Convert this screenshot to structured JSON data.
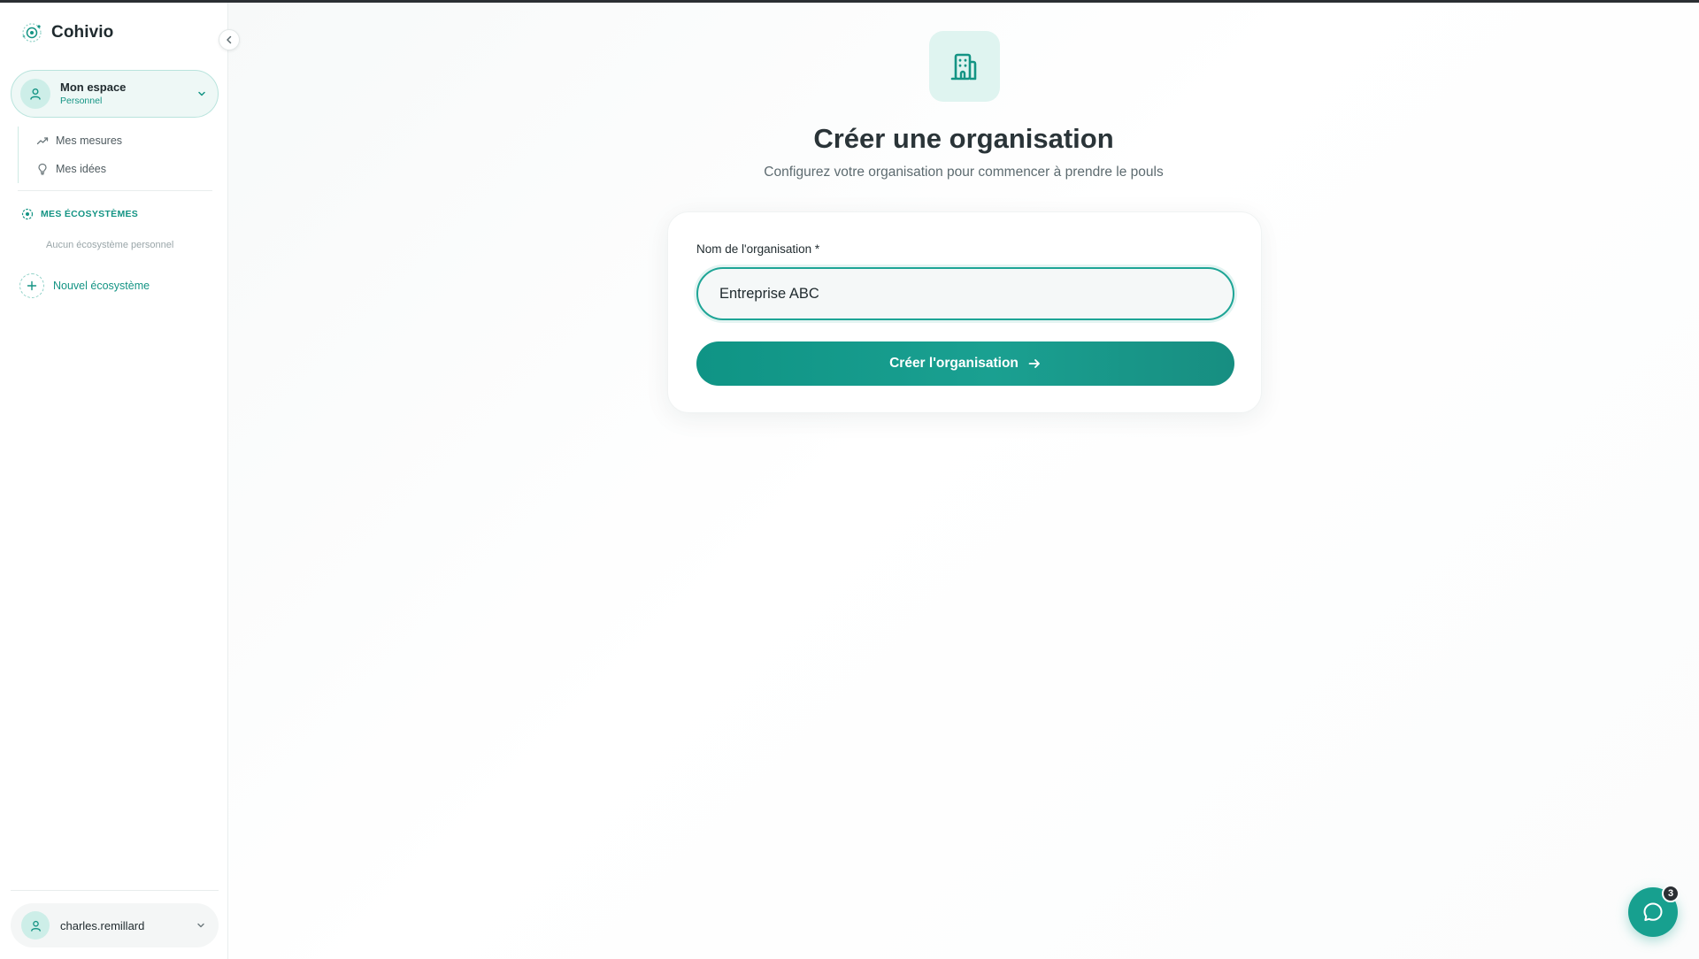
{
  "brand": {
    "name": "Cohivio"
  },
  "workspace": {
    "title": "Mon espace",
    "subtitle": "Personnel"
  },
  "subnav": {
    "items": [
      {
        "label": "Mes mesures",
        "icon": "trending-up-icon"
      },
      {
        "label": "Mes idées",
        "icon": "lightbulb-icon"
      }
    ]
  },
  "ecosystems": {
    "section_title": "MES ÉCOSYSTÈMES",
    "empty_note": "Aucun écosystème personnel",
    "new_label": "Nouvel écosystème"
  },
  "user": {
    "name": "charles.remillard"
  },
  "main": {
    "icon": "building-icon",
    "title": "Créer une organisation",
    "subtitle": "Configurez votre organisation pour commencer à prendre le pouls"
  },
  "form": {
    "org_name_label": "Nom de l'organisation *",
    "org_name_value": "Entreprise ABC",
    "submit_label": "Créer l'organisation"
  },
  "chat": {
    "badge_count": "3"
  },
  "colors": {
    "accent": "#149484",
    "accent_light": "#dff4f0",
    "dark": "#2b2f33"
  }
}
